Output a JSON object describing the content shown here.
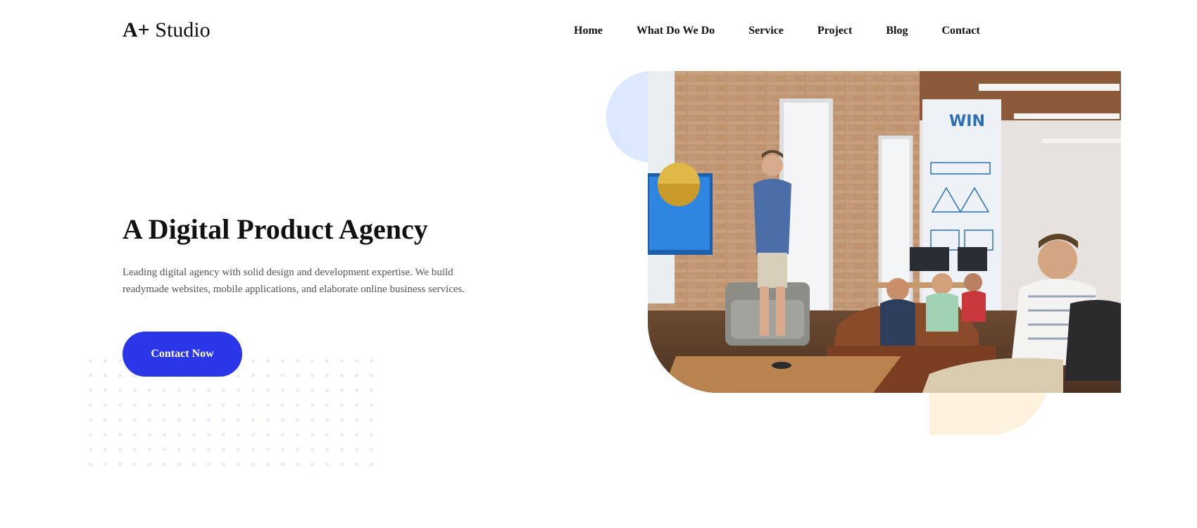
{
  "brand": {
    "bold": "A+",
    "rest": " Studio"
  },
  "nav": {
    "items": [
      {
        "label": "Home"
      },
      {
        "label": "What Do We Do"
      },
      {
        "label": "Service"
      },
      {
        "label": "Project"
      },
      {
        "label": "Blog"
      },
      {
        "label": "Contact"
      }
    ]
  },
  "hero": {
    "title": "A Digital Product Agency",
    "description": "Leading digital agency with solid design and development expertise. We build readymade websites, mobile applications, and elaborate online business services.",
    "cta_label": "Contact Now",
    "photo_wall_text": "WIN"
  },
  "colors": {
    "accent": "#2a36e8",
    "blob_blue": "#dbe8ff",
    "blob_yellow": "#fdf3dc",
    "dots": "#e9ecf2"
  }
}
